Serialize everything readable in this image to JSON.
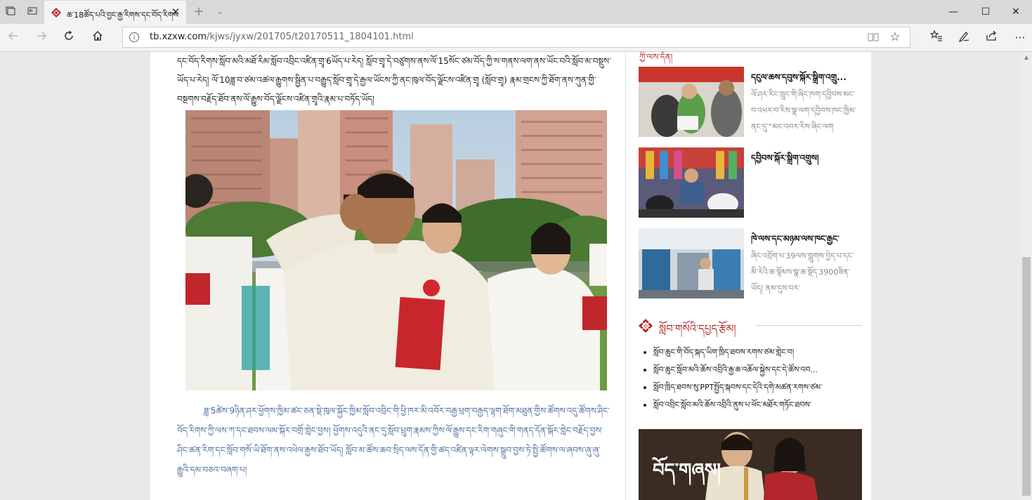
{
  "browser": {
    "tab_title": "ཆ་18ཚོད་པའི་བྱང་རྒྱ་རིགས་དང་བོད་རིགས",
    "url_host": "tb.xzxw.com",
    "url_path": "/kjws/jyxw/201705/t20170511_1804101.html",
    "window_controls": {
      "minimize": "—",
      "maximize": "☐",
      "close": "✕"
    }
  },
  "article": {
    "para_top": "དང་བོད་རིགས་སློབ་མའི་མཐོ་རིམ་སློབ་འབྲིང་འཛིན་གྲྭ་6ཡོད་པ་རེད། སློབ་གྲྭ་དེ་བཙུགས་ནས་ལོ་15སོང་ཙམ་བོད་ཀྱི་ས་གནས་ལག་ནས་ཡོང་བའི་སློབ་མ་བསྡུས་ཡོད་པ་རེད། ལོ་10ཟླ་བ་ཙམ་འཚལ་རྒྱུགས་སྦྱིན་པ་བརྒྱུད་སློབ་གྲྭ་དེ་རྒྱལ་ཡོངས་ཀྱི་ནང་ཁུལ་བོད་ལྗོངས་འཛིན་གྲྭ (སློབ་གྲྭ) རྣམ་གྲངས་ཀྱི་ཐོག་ནས་ཀུན་གྱི་བསྔགས་བརྗོད་ཐོབ་ནས་ལོ་རྒྱུས་བོད་ལྗོངས་འཛིན་གྲྭའི་རྣམ་པ་བཏོད་ཡོད།",
    "para_bottom": "ཟླ་5ཚེས་9ཉིན་ཤར་ཕྱོགས་ཁྱིམ་ཚང་ཅན་སྡེ་ཁུལ་སྐྱོང་ཁྱིམ་སློབ་འབྲིང་གི་ཕྱི་ཁར་མི་འབོར་བརྒྱ་ཕྲག་བརྒྱད་ལྷག་ཐོག་མཐུན་གྱིས་ཚོགས་འདུ་ཚོགས་ཤིང་བོད་རིགས་ཀྱི་ལས་ཀ་དང་ཐབས་ལམ་སྐོར་བགྲོ་གླེང་བྱས། ཕྱོགས་འདུའི་ནང་དུ་སློབ་ཕྲུག་རྣམས་ཀྱིས་ལོ་རྒྱུས་དང་རིག་གཞུང་གི་གནད་དོན་སྐོར་གླེང་བརྗོད་བྱས་ཤིང་ཚན་རིག་དང་སློབ་གསོ་ཡི་ཐོག་ནས་འཕེལ་རྒྱས་ཐོབ་ཡོད། སློབ་མ་ཚོས་ཆབ་སྲིད་ལས་དོན་གྱི་ཚད་འཛིན་ལྟར་ལེགས་སྒྲུབ་བྱས་ཏེ་སྤྱི་ཚོགས་ལ་ཞབས་ཞུ་ཞུ་རྒྱུའི་དམ་བཅའ་བཞག་པ།"
  },
  "sidebar": {
    "section_cut_title": "ཀྱི་ལས་དོན།",
    "cards": [
      {
        "title": "དངུལ་ཆས་དབུས་སྐོར་སྒྲིག་འགྲུ...",
        "summary": "ལོ་ཤར་རིང་ཁྲུང་གི་ཞིང་ཁག་དབྱིབས་མང་བ་འཕར་བ་རིས་སྣ་ལག་དབྱིབས་ཁང་ཁྱིམ་ནང་དུ་“མང་འབར་རིས་ཞིང་ལག"
      },
      {
        "title": "དབྱིབས་སྐོར་སྒྲིག་འགྲུས།",
        "summary": ""
      },
      {
        "title": "ཁེ་ལས་དང་མཉམ་ལས་ཁང་རྒྱང་",
        "summary": "ཞིང་འབྲོག་པ་39ལས་གླུགས་བྱེད་པ་དང་མི་རེའི་ཆ་སྙོམས་སྣ་ཆ་སྡོད་3900ཟིན་ཡོད། ནམ་དུས་བར་"
      }
    ],
    "section": {
      "title": "སློབ་གསོའི་དཔྱད་རྩོམ།",
      "items": [
        "སློབ་ཆུང་གི་བོད་སྐད་ཡིག་ཁྲིད་ཐབས་རགས་ཙམ་གླེང་བ།",
        "སློབ་ཆུང་སློབ་མའི་ཆོས་འབྲིའི་རྒྱ་ཆ་འཆོལ་སྐྱེས་དང་དེ་ཚོས་འབ...",
        "སློབ་ཁྲིད་ཐབས་སུ་PPTསྤྱོད་སྐབས་དང་དེའི་དགེ་མཚན་རགས་ཙམ་",
        "སློབ་འབྲིང་སློབ་མའི་ཆོས་འབྲིའི་ནུས་པ་ཕོང་མཐོར་གཏོང་ཐབས་"
      ]
    },
    "banner_text": "བོད་གཞས།"
  },
  "colors": {
    "accent_red": "#b32a2a",
    "article_text": "#1a1a1a",
    "article_blue": "#4a6c9b",
    "summary_gray": "#888888"
  },
  "icons": [
    "tabs-icon",
    "set-aside-icon",
    "favicon",
    "close-tab-icon",
    "new-tab-icon",
    "tab-preview-icon",
    "back-icon",
    "forward-icon",
    "refresh-icon",
    "home-icon",
    "info-icon",
    "reading-view-icon",
    "favorite-star-icon",
    "favorites-hub-icon",
    "pen-icon",
    "share-icon",
    "more-icon"
  ]
}
